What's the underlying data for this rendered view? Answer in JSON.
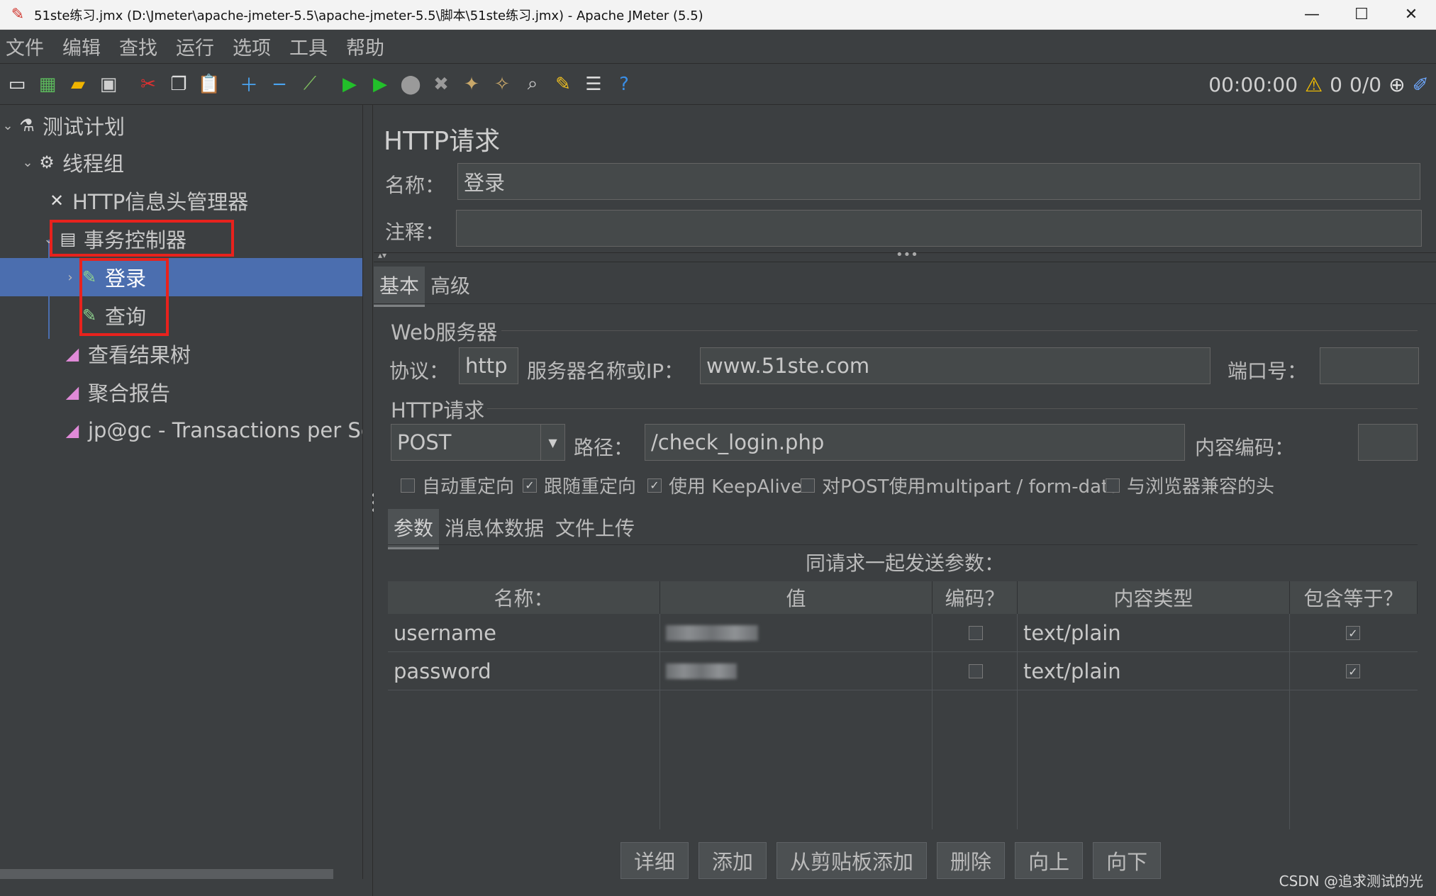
{
  "window": {
    "title": "51ste练习.jmx (D:\\Jmeter\\apache-jmeter-5.5\\apache-jmeter-5.5\\脚本\\51ste练习.jmx) - Apache JMeter (5.5)",
    "minimize": "—",
    "maximize": "☐",
    "close": "✕"
  },
  "menu": [
    "文件",
    "编辑",
    "查找",
    "运行",
    "选项",
    "工具",
    "帮助"
  ],
  "toolbar": {
    "timer": "00:00:00",
    "warnings": "0",
    "threads": "0/0"
  },
  "tree": {
    "test_plan": "测试计划",
    "thread_group": "线程组",
    "header_manager": "HTTP信息头管理器",
    "transaction_controller": "事务控制器",
    "login": "登录",
    "query": "查询",
    "result_tree": "查看结果树",
    "aggregate_report": "聚合报告",
    "tps": "jp@gc - Transactions per Second"
  },
  "panel": {
    "title": "HTTP请求",
    "name_label": "名称：",
    "name_value": "登录",
    "comment_label": "注释：",
    "comment_value": "",
    "tabs": [
      "基本",
      "高级"
    ],
    "web_server": "Web服务器",
    "protocol_label": "协议：",
    "protocol_value": "http",
    "server_label": "服务器名称或IP：",
    "server_value": "www.51ste.com",
    "port_label": "端口号：",
    "port_value": "",
    "http_request": "HTTP请求",
    "method": "POST",
    "path_label": "路径：",
    "path_value": "/check_login.php",
    "encoding_label": "内容编码：",
    "encoding_value": "",
    "options": [
      {
        "label": "自动重定向",
        "checked": false
      },
      {
        "label": "跟随重定向",
        "checked": true
      },
      {
        "label": "使用 KeepAlive",
        "checked": true
      },
      {
        "label": "对POST使用multipart / form-data",
        "checked": false
      },
      {
        "label": "与浏览器兼容的头",
        "checked": false
      }
    ],
    "sub_tabs": [
      "参数",
      "消息体数据",
      "文件上传"
    ],
    "params_caption": "同请求一起发送参数：",
    "columns": [
      "名称：",
      "值",
      "编码？",
      "内容类型",
      "包含等于？"
    ],
    "rows": [
      {
        "name": "username",
        "encode": false,
        "content_type": "text/plain",
        "include_equals": true
      },
      {
        "name": "password",
        "encode": false,
        "content_type": "text/plain",
        "include_equals": true
      }
    ],
    "buttons": [
      "详细",
      "添加",
      "从剪贴板添加",
      "删除",
      "向上",
      "向下"
    ]
  },
  "watermark": "CSDN @追求测试的光"
}
